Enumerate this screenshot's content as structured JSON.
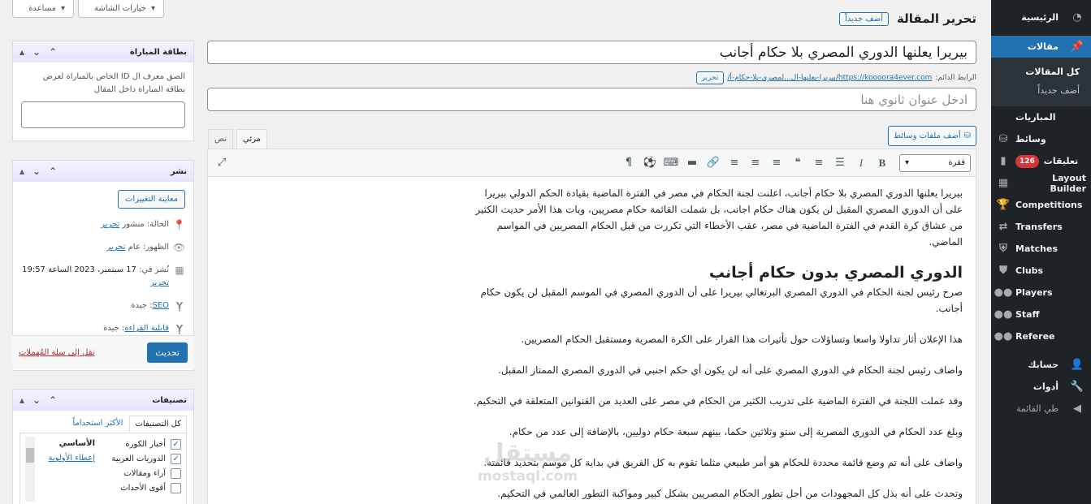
{
  "screen_options": {
    "screen_label": "خيارات الشاشة",
    "help_label": "مساعدة"
  },
  "menu": {
    "dashboard": "الرئيسية",
    "posts": "مقالات",
    "posts_sub": {
      "all": "كل المقالات",
      "add": "أضف جديداً"
    },
    "matches_ar": "المباريات",
    "media": "وسائط",
    "comments": "تعليقات",
    "comments_count": "126",
    "layout_builder": "Layout Builder",
    "competitions": "Competitions",
    "transfers": "Transfers",
    "matches": "Matches",
    "clubs": "Clubs",
    "players": "Players",
    "staff": "Staff",
    "referee": "Referee",
    "account": "حسابك",
    "tools": "أدوات",
    "collapse": "طي القائمة"
  },
  "header": {
    "title": "تحرير المقالة",
    "add_new": "أضف جديداً"
  },
  "post": {
    "title": "بيريرا يعلنها الدوري المصري بلا حكام أجانب",
    "permalink_label": "الرابط الدائم:",
    "permalink_url": "https://koooora4ever.com/بيريرا-يعلنها-ال...لمصري-بلا-حكام-أ/",
    "edit_label": "تحرير",
    "subtitle_placeholder": "ادخل عنوان ثانوي هنا"
  },
  "editor": {
    "add_media": "أضف ملفات وسائط",
    "tab_visual": "مرئي",
    "tab_text": "نص",
    "format": "فقرة",
    "content": {
      "p1": "بيريرا يعلنها الدوري المصري بلا حكام أجانب، اعلنت لجنة الحكام في مصر في الفترة الماضية بقيادة الحكم الدولي بيريرا على أن الدوري المصري المقبل لن يكون هناك حكام اجانب، بل شملت القائمة حكام مصريين، وبات هذا الأمر حديث الكثير من عشاق كرة القدم في الفترة الماضية في مصر، عقب الأخطاء التي تكررت من قبل الحكام المصريين في المواسم الماضي.",
      "h2": "الدوري المصري بدون حكام أجانب",
      "p2": "صرح رئيس لجنة الحكام في الدوري المصري البرتغالي بيريرا على أن الدوري المصري في الموسم المقبل لن يكون حكام أجانب.",
      "p3": "هذا الإعلان أثار تداولا واسعا وتساؤلات حول تأثيرات هذا القرار على الكرة المصرية ومستقبل الحكام المصريين.",
      "p4": "واضاف رئيس لجنة الحكام في الدوري المصري على أنه لن يكون أي حكم اجنبي في الدوري المصري الممتاز المقبل.",
      "p5": "وقد عملت اللجنة في الفترة الماضية على تدريب الكثير من الحكام في مصر على العديد من القنوانين المتعلقة في التحكيم.",
      "p6": "وبلغ عدد الحكام في الدوري المصرية إلى ستو وثلاثين حكما، بينهم سبعة حكام دوليين، بالإضافة إلى عدد من حكام.",
      "p7": "واضاف على أنه تم وضع قائمة محددة للحكام هو أمر طبيعي مثلما تقوم به كل الفريق في بداية كل موسم بتحديد قائمته.",
      "p8": "وتحدث على أنه بذل كل المجهودات من أجل تطور الحكام المصريين بشكل كبير ومواكبة التطور العالمي في التحكيم."
    },
    "watermark": {
      "ar": "مستقل",
      "en": "mostaql.com"
    }
  },
  "match_box": {
    "title": "بطاقة المباراة",
    "text": "الصق معرف ال ID الخاص بالمباراة لعرض بطاقة المباراة داخل المقال",
    "input_value": ""
  },
  "publish": {
    "title": "نشر",
    "preview": "معاينة التغييرات",
    "status_label": "الحالة:",
    "status_value": "منشور",
    "visibility_label": "الظهور:",
    "visibility_value": "عام",
    "published_label": "نُشر في:",
    "published_value": "17 سبتمبر، 2023 الساعة 19:57",
    "edit": "تحرير",
    "seo_label": "SEO",
    "seo_value": ": جيدة",
    "readability_label": "قابلية القراءة",
    "readability_value": ": جيدة",
    "trash": "نقل إلى سلة المُهملات",
    "update": "تحديث"
  },
  "categories": {
    "title": "تصنيفات",
    "tab_all": "كل التصنيفات",
    "tab_popular": "الأكثر استخداماً",
    "items": [
      {
        "label": "أخبار الكورة",
        "checked": true
      },
      {
        "label": "الدوريات العربية",
        "checked": true
      },
      {
        "label": "آراء ومقالات",
        "checked": false
      },
      {
        "label": "أقوى الأحداث",
        "checked": false
      }
    ],
    "primary": "الأساسي",
    "make_primary": "إعطاء الأولوية"
  }
}
